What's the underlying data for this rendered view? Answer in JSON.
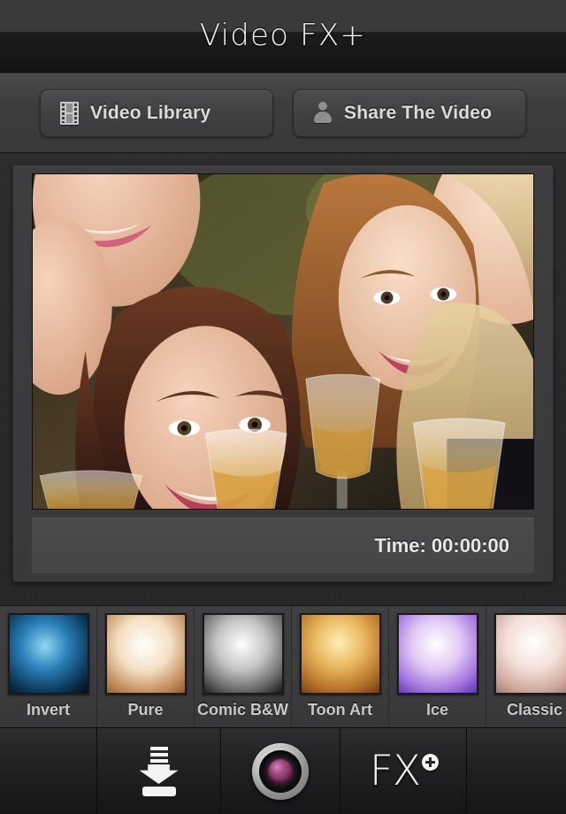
{
  "app": {
    "title": "Video FX+"
  },
  "topbar": {
    "library_button": {
      "label": "Video Library",
      "icon": "film-strip-icon"
    },
    "share_button": {
      "label": "Share The Video",
      "icon": "person-icon"
    }
  },
  "preview": {
    "time_label": "Time: 00:00:00",
    "media_description": "Three smiling young women cheering with champagne glasses"
  },
  "filters": {
    "items": [
      {
        "label": "Invert",
        "thumb_colors": [
          "#0a0a0a",
          "#1d6fa8",
          "#6fc3e8"
        ]
      },
      {
        "label": "Pure",
        "thumb_colors": [
          "#ffffff",
          "#f2d7b8",
          "#b0825a"
        ]
      },
      {
        "label": "Comic B&W",
        "thumb_colors": [
          "#ffffff",
          "#9a9a9a",
          "#1a1a1a"
        ]
      },
      {
        "label": "Toon Art",
        "thumb_colors": [
          "#fbe6a0",
          "#c9792c",
          "#7a3f12"
        ]
      },
      {
        "label": "Ice",
        "thumb_colors": [
          "#ffffff",
          "#d9bdf0",
          "#6b3fc4"
        ]
      },
      {
        "label": "Classic",
        "thumb_colors": [
          "#ffffff",
          "#efd9d3",
          "#b08a82"
        ]
      }
    ]
  },
  "toolbar": {
    "buttons": [
      {
        "name": "save-button",
        "icon": "download-icon"
      },
      {
        "name": "record-button",
        "icon": "camera-lens-icon"
      },
      {
        "name": "fx-button",
        "icon": "fx-plus-icon",
        "label": "FX"
      }
    ]
  },
  "colors": {
    "accent": "#a64e85",
    "panel": "#3d3d3f",
    "text": "#dcdcdc"
  }
}
